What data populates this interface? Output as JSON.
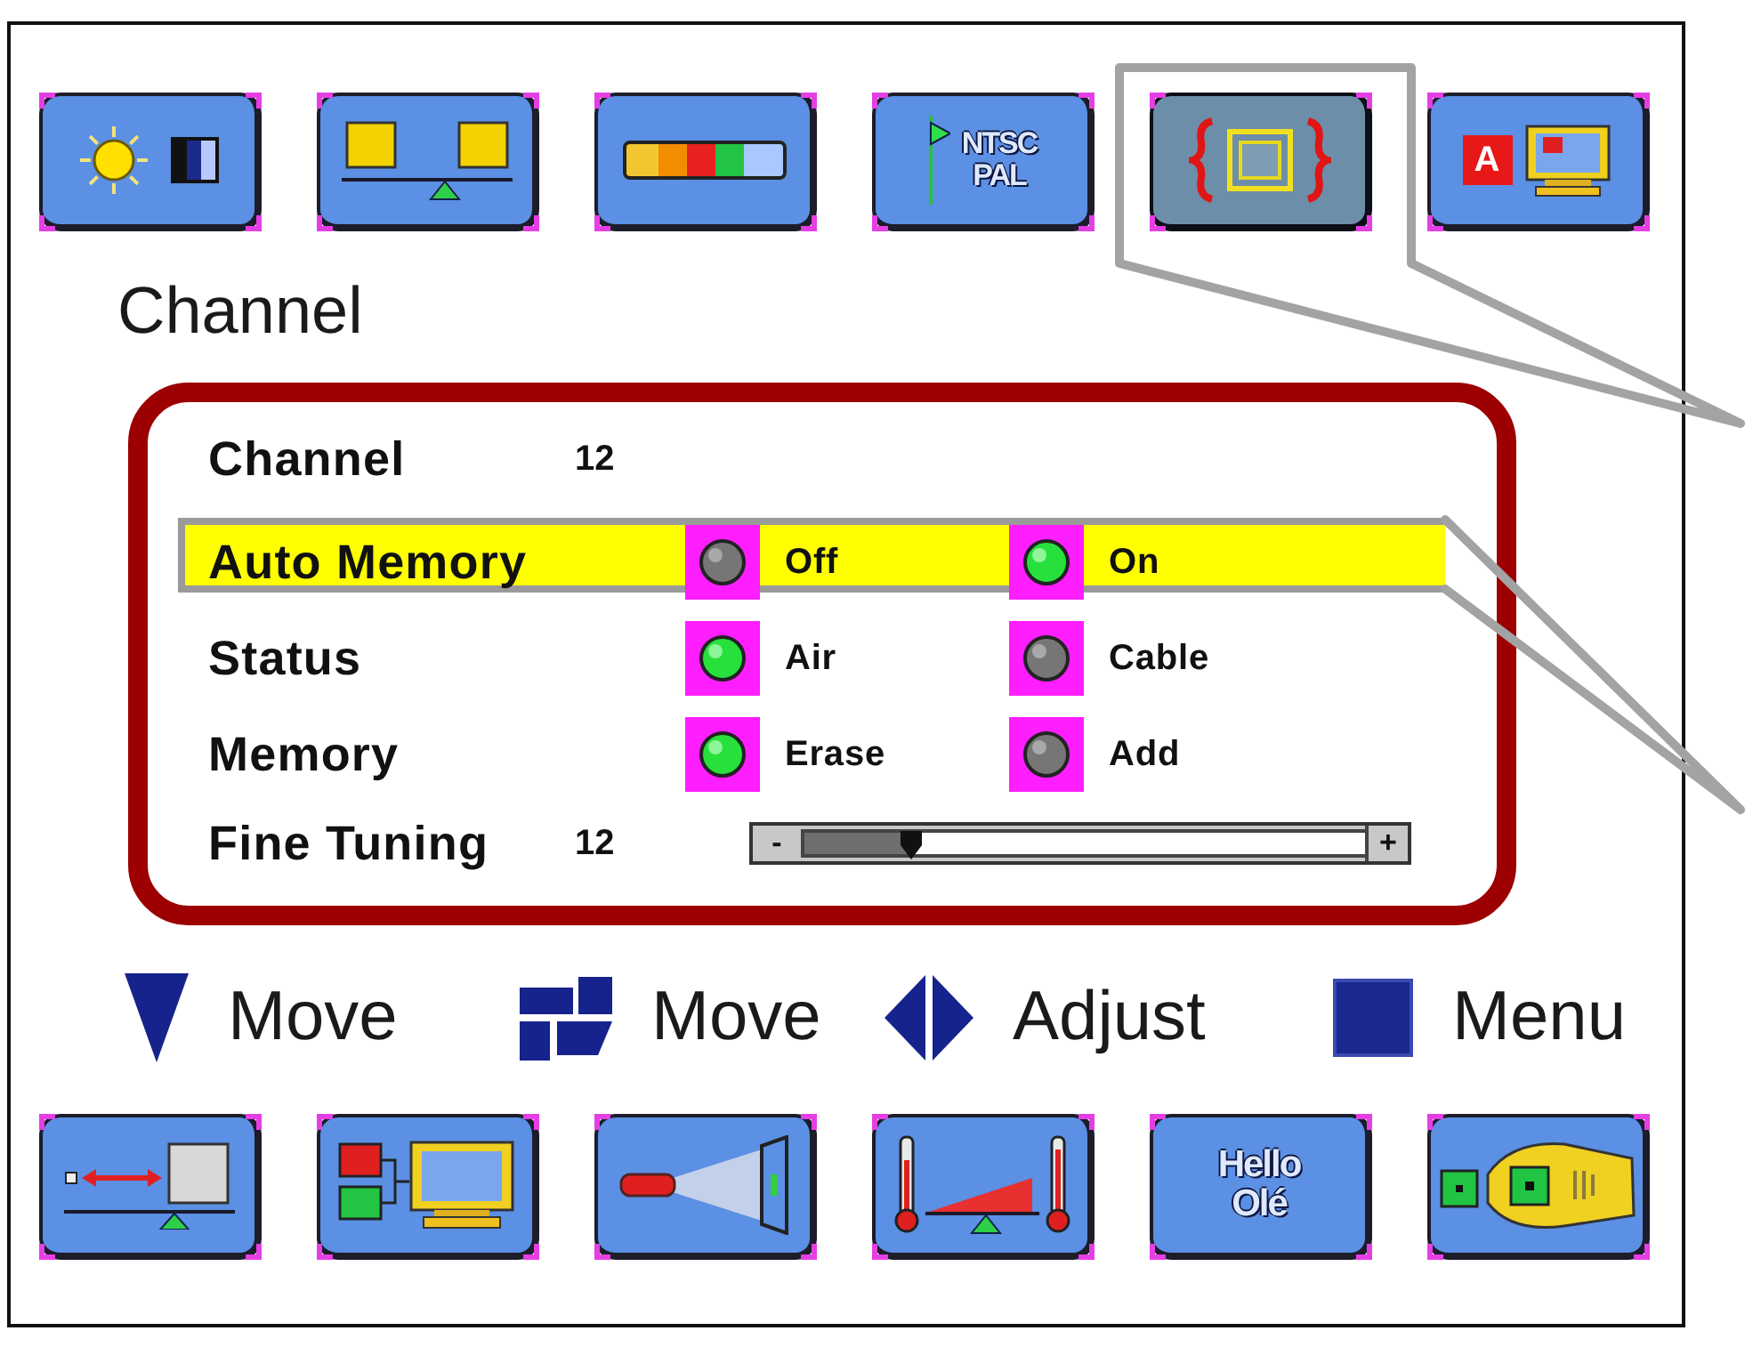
{
  "top_menu": [
    {
      "kind": "brightness",
      "selected": false
    },
    {
      "kind": "balance",
      "selected": false
    },
    {
      "kind": "color-bar",
      "selected": false
    },
    {
      "kind": "ntsc-pal",
      "selected": false,
      "lines": [
        "NTSC",
        "PAL"
      ]
    },
    {
      "kind": "frame",
      "selected": true
    },
    {
      "kind": "letter-monitor",
      "selected": false,
      "letter": "A"
    }
  ],
  "settings": {
    "title": "Channel",
    "rows": [
      {
        "kind": "value",
        "label": "Channel",
        "value": "12",
        "selected": false
      },
      {
        "kind": "choice",
        "label": "Auto Memory",
        "selected": true,
        "options": [
          {
            "label": "Off",
            "selected": false
          },
          {
            "label": "On",
            "selected": true
          }
        ]
      },
      {
        "kind": "choice",
        "label": "Status",
        "selected": false,
        "options": [
          {
            "label": "Air",
            "selected": true
          },
          {
            "label": "Cable",
            "selected": false
          }
        ]
      },
      {
        "kind": "choice",
        "label": "Memory",
        "selected": false,
        "options": [
          {
            "label": "Erase",
            "selected": true
          },
          {
            "label": "Add",
            "selected": false
          }
        ]
      },
      {
        "kind": "slider",
        "label": "Fine Tuning",
        "value": "12",
        "selected": false,
        "level": 0.19,
        "decrease_label": "-",
        "increase_label": "+"
      }
    ]
  },
  "legend": [
    {
      "kind": "down",
      "label": "Move"
    },
    {
      "kind": "blocks",
      "label": "Move"
    },
    {
      "kind": "left-right",
      "label": "Adjust"
    },
    {
      "kind": "square",
      "label": "Menu"
    }
  ],
  "bottom_menu": [
    {
      "kind": "seesaw-arrow",
      "selected": false
    },
    {
      "kind": "tiles-monitor",
      "selected": false
    },
    {
      "kind": "projector",
      "selected": false
    },
    {
      "kind": "thermometers",
      "selected": false
    },
    {
      "kind": "greeting",
      "selected": false,
      "lines": [
        "Hello",
        "Olé"
      ]
    },
    {
      "kind": "hand-remote",
      "selected": false
    }
  ]
}
